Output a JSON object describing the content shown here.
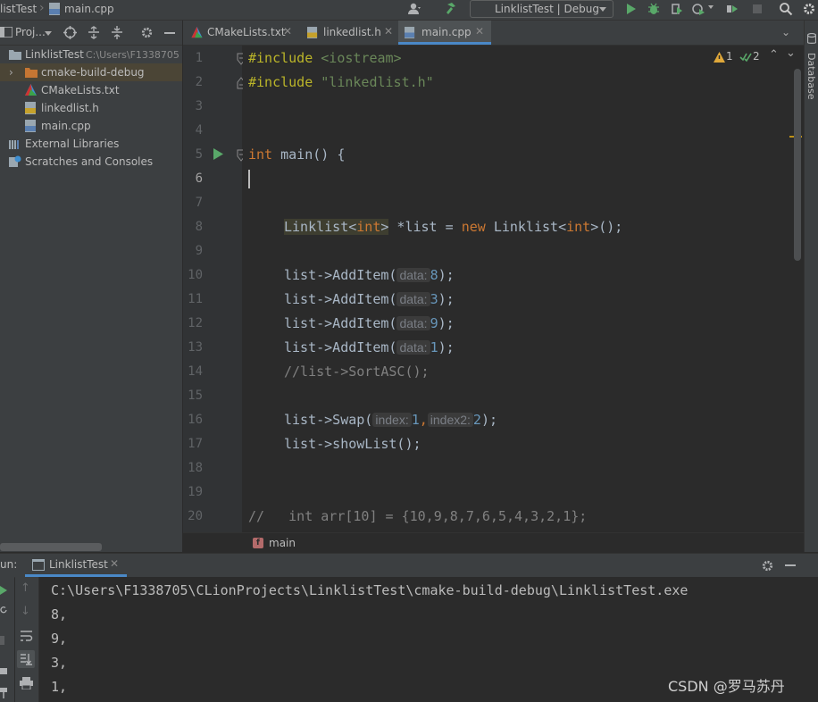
{
  "navbar": {
    "project": "listTest",
    "file": "main.cpp",
    "run_config": "LinklistTest | Debug"
  },
  "project_panel": {
    "title": "Proj...",
    "root": {
      "name": "LinklistTest",
      "path": "C:\\Users\\F1338705"
    },
    "items": [
      {
        "name": "cmake-build-debug"
      },
      {
        "name": "CMakeLists.txt"
      },
      {
        "name": "linkedlist.h"
      },
      {
        "name": "main.cpp"
      },
      {
        "name": "External Libraries"
      },
      {
        "name": "Scratches and Consoles"
      }
    ]
  },
  "tabs": [
    {
      "label": "CMakeLists.txt"
    },
    {
      "label": "linkedlist.h"
    },
    {
      "label": "main.cpp"
    }
  ],
  "inspections": {
    "warnings": "1",
    "checks": "2"
  },
  "side_strip": {
    "label": "Database"
  },
  "gutter": {
    "lines": [
      "1",
      "2",
      "3",
      "4",
      "5",
      "6",
      "7",
      "8",
      "9",
      "10",
      "11",
      "12",
      "13",
      "14",
      "15",
      "16",
      "17",
      "18",
      "19",
      "20"
    ]
  },
  "code": {
    "l1_directive": "#include",
    "l1_arg": " <iostream>",
    "l2_directive": "#include",
    "l2_arg": " \"linkedlist.h\"",
    "l5_kw": "int",
    "l5_rest": " main() {",
    "l8_cls": "Linklist",
    "l8_lt": "<",
    "l8_kw": "int",
    "l8_gt": ">",
    "l8_mid": " *list = ",
    "l8_new": "new",
    "l8_sp": " ",
    "l8_cls2": "Linklist",
    "l8_lt2": "<",
    "l8_kw2": "int",
    "l8_end": ">();",
    "add_call": "list->AddItem(",
    "hint_data": "data:",
    "add_values": [
      "8",
      "3",
      "9",
      "1"
    ],
    "close_semi": ");",
    "l14": "//list->SortASC();",
    "l16_call": "list->Swap(",
    "hint_index": "index:",
    "l16_v1": "1",
    "comma": ",",
    "hint_index2": "index2:",
    "l16_v2": "2",
    "l17": "list->showList();",
    "l20": "//   int arr[10] = {10,9,8,7,6,5,4,3,2,1};"
  },
  "breadcrumb": {
    "label": "main"
  },
  "run": {
    "prefix": "un:",
    "tab": "LinklistTest"
  },
  "console": {
    "lines": [
      "C:\\Users\\F1338705\\CLionProjects\\LinklistTest\\cmake-build-debug\\LinklistTest.exe",
      "8,",
      "9,",
      "3,",
      "1,"
    ]
  },
  "watermark": "CSDN @罗马苏丹"
}
